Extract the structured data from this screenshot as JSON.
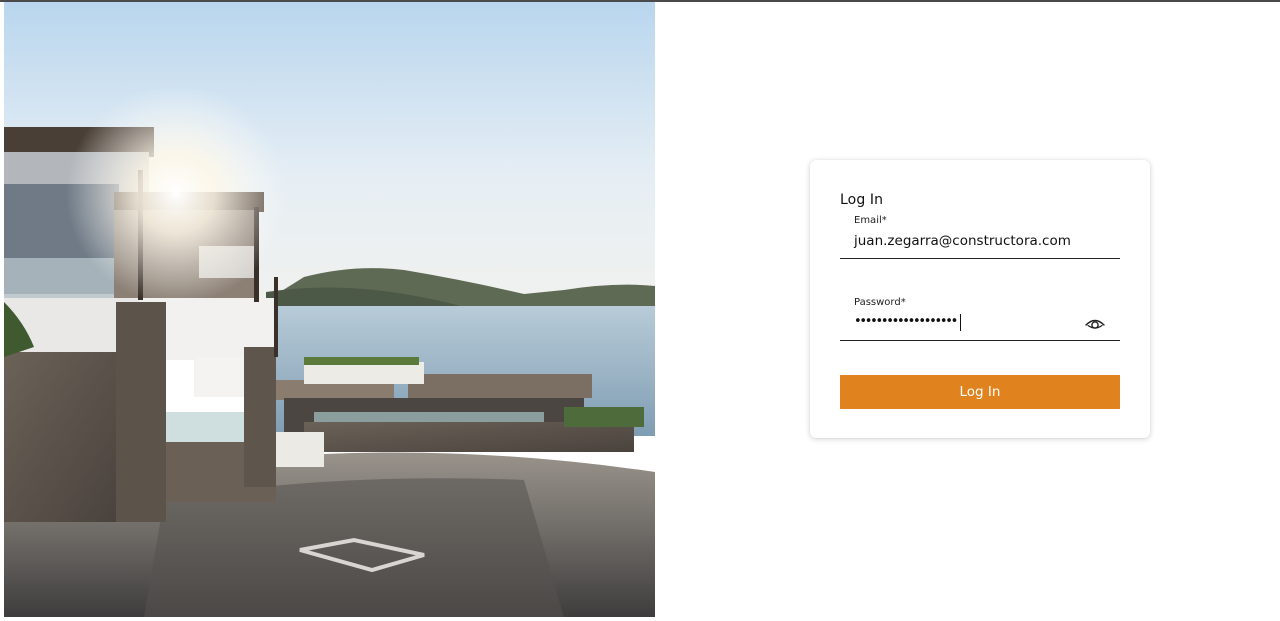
{
  "hero": {
    "image_description": ""
  },
  "login": {
    "title": "Log In",
    "email": {
      "label": "Email*",
      "value": "juan.zegarra@constructora.com"
    },
    "password": {
      "label": "Password*",
      "masked_value": "•••••••••••••••••••"
    },
    "submit_label": "Log In"
  },
  "colors": {
    "accent": "#e0821e",
    "text": "#111111",
    "background": "#ffffff"
  },
  "icons": {
    "password_toggle": "eye-icon"
  }
}
